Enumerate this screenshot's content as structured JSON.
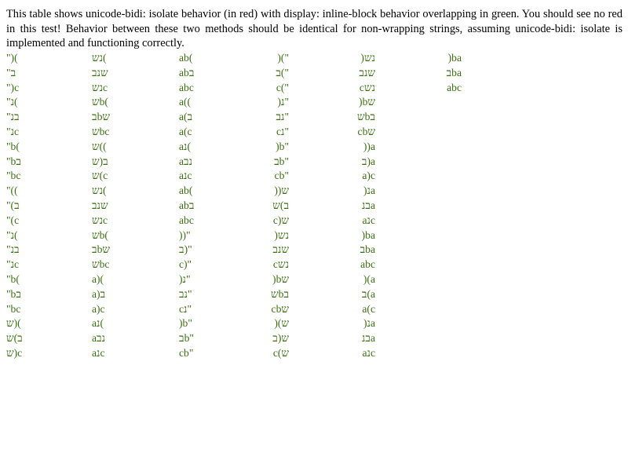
{
  "intro": "This table shows unicode-bidi: isolate behavior (in red) with display: inline-block behavior overlapping in green. You should see no red in this test! Behavior between these two methods should be identical for non-wrapping strings, assuming unicode-bidi: isolate is implemented and functioning correctly.",
  "colors": {
    "green": "#3b6e10",
    "red": "#ff0000"
  },
  "columns": [
    {
      "align": "left",
      "cells": [
        "\")(",
        "\"ב‎",
        "\")c",
        "\"נ(",
        "\"בנ",
        "\"נc",
        "\"b(",
        "\"bב",
        "\"bc",
        "\"((",
        "\"(ב",
        "\"(c",
        "\"נ(",
        "\"בנ",
        "\"נc",
        "\"b(",
        "\"bב",
        "\"bc",
        "ש)(",
        "ב)ש",
        "ש)c"
      ]
    },
    {
      "align": "left",
      "cells": [
        "נש(",
        "שנב",
        "נשc",
        "שb(",
        "בbש",
        "שbc",
        "ש((",
        "ב(ש",
        "ש(c",
        "נש(",
        "שנב",
        "נשc",
        "שb(",
        "בbש",
        "שbc",
        "a)(",
        "a)ב",
        "a)c",
        "aנ(",
        "aנב",
        "aנc"
      ]
    },
    {
      "align": "left",
      "cells": [
        "ab(",
        "abב",
        "abc",
        "a((",
        "a(ב",
        "a(c",
        "aנ(",
        "aנב",
        "aנc",
        "ab(",
        "abב",
        "abc",
        "))\"",
        "ב)\"",
        "c)\"",
        ")נ\"",
        "נב\"",
        "cנ\"",
        ")b\"",
        "בb\"",
        "cb\""
      ]
    },
    {
      "align": "right",
      "cells": [
        ")(\"",
        "ב(\"",
        "c(\"",
        ")נ\"",
        "נב\"",
        "cנ\"",
        ")b\"",
        "בb\"",
        "cb\"",
        "))ש",
        "ב)ש",
        "c)ש",
        ")נש",
        "שנב",
        "cנש",
        ")bש",
        "שbב",
        "cbש",
        ")(ש",
        "ש(ב",
        "c(ש"
      ]
    },
    {
      "align": "right",
      "cells": [
        ")נש",
        "שנב",
        "cנש",
        ")bש",
        "שbב",
        "cbש",
        "))a",
        "ב)a",
        "a)c",
        ")נa",
        "בנa",
        "aנc",
        ")ba",
        "בba",
        "abc",
        ")(a",
        "ב(a",
        "a(c",
        ")נa",
        "בנa",
        "aנc"
      ]
    },
    {
      "align": "right",
      "cells": [
        ")ba",
        "בba",
        "abc"
      ]
    }
  ]
}
